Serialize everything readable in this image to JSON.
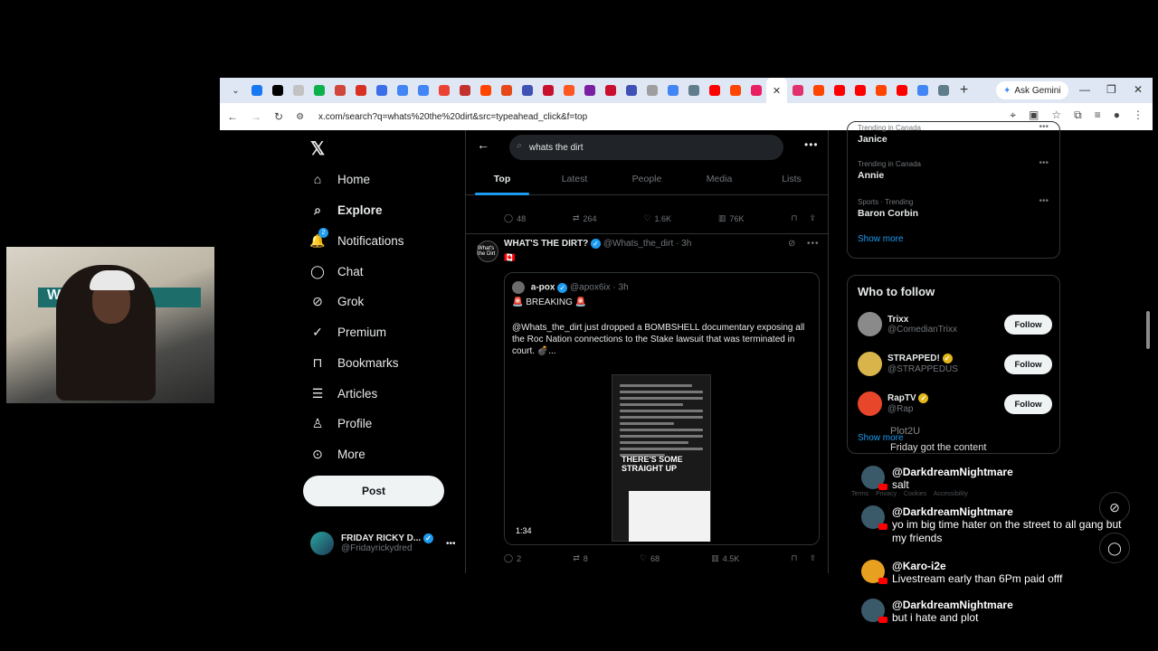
{
  "browser": {
    "url": "x.com/search?q=whats%20the%20dirt&src=typeahead_click&f=top",
    "gemini_label": "Ask Gemini",
    "tab_colors": [
      "#1877f2",
      "#000000",
      "#c2c2c2",
      "#0db14b",
      "#d1463a",
      "#d93025",
      "#3b6ee8",
      "#4285f4",
      "#4285f4",
      "#ea4335",
      "#c4302b",
      "#ff4500",
      "#e64a19",
      "#3f51b5",
      "#c8102e",
      "#ff5722",
      "#7b1fa2",
      "#c8102e",
      "#3f51b5",
      "#9e9e9e",
      "#4285f4",
      "#607d8b",
      "#ff0000",
      "#ff4500",
      "#e91e63"
    ],
    "tab_colors_after": [
      "#e1306c",
      "#ff4500",
      "#ff0000",
      "#ff0000",
      "#ff4500",
      "#ff0000",
      "#4285f4",
      "#607d8b"
    ]
  },
  "nav": {
    "logo": "𝕏",
    "items": [
      {
        "label": "Home",
        "icon": "home-icon",
        "glyph": "⌂"
      },
      {
        "label": "Explore",
        "icon": "search-icon",
        "glyph": "⌕"
      },
      {
        "label": "Notifications",
        "icon": "bell-icon",
        "glyph": "🔔"
      },
      {
        "label": "Chat",
        "icon": "chat-icon",
        "glyph": "◯"
      },
      {
        "label": "Grok",
        "icon": "grok-icon",
        "glyph": "⊘"
      },
      {
        "label": "Premium",
        "icon": "premium-icon",
        "glyph": "✓"
      },
      {
        "label": "Bookmarks",
        "icon": "bookmark-icon",
        "glyph": "⊓"
      },
      {
        "label": "Articles",
        "icon": "article-icon",
        "glyph": "☰"
      },
      {
        "label": "Profile",
        "icon": "profile-icon",
        "glyph": "♙"
      },
      {
        "label": "More",
        "icon": "more-icon",
        "glyph": "⊙"
      }
    ],
    "notif_count": "2",
    "post": "Post",
    "me": {
      "name": "FRIDAY RICKY D...",
      "handle": "@Fridayrickydred"
    }
  },
  "search": {
    "query": "whats the dirt",
    "tabs": [
      "Top",
      "Latest",
      "People",
      "Media",
      "Lists"
    ]
  },
  "prev_tweet_actions": {
    "replies": "48",
    "reposts": "264",
    "likes": "1.6K",
    "views": "76K"
  },
  "tweet": {
    "name": "WHAT'S THE DIRT?",
    "handle": "@Whats_the_dirt",
    "time": "· 3h",
    "flag": "🇨🇦",
    "avatar_text": "What's the Dirt",
    "quote": {
      "name": "a-pox",
      "handle": "@apox6ix",
      "time": "· 3h",
      "line1": "🚨 BREAKING 🚨",
      "line2": "@Whats_the_dirt just dropped a BOMBSHELL documentary exposing all the Roc Nation connections to the Stake lawsuit that was terminated in court. 💣...",
      "video_duration": "1:34",
      "overlay_line1": "THERE'S SOME",
      "overlay_line2": "STRAIGHT UP"
    },
    "actions": {
      "replies": "2",
      "reposts": "8",
      "likes": "68",
      "views": "4.5K"
    }
  },
  "trends": [
    {
      "context": "Trending in Canada",
      "title": "Janice"
    },
    {
      "context": "Trending in Canada",
      "title": "Annie"
    },
    {
      "context": "Sports · Trending",
      "title": "Baron Corbin"
    }
  ],
  "show_more": "Show more",
  "who_to_follow": {
    "title": "Who to follow",
    "follow_label": "Follow",
    "accounts": [
      {
        "name": "Trixx",
        "handle": "@ComedianTrixx",
        "color": "#8a8a8a"
      },
      {
        "name": "STRAPPED!",
        "handle": "@STRAPPEDUS",
        "color": "#d9b44a"
      },
      {
        "name": "RapTV",
        "handle": "@Rap",
        "color": "#e8462b"
      }
    ]
  },
  "footer": "Terms Privacy Cookies Accessibility",
  "chat": {
    "ghost_user": "Plot2U",
    "ghost_text": "Friday got the content",
    "messages": [
      {
        "user": "@DarkdreamNightmare",
        "text": "salt",
        "color": "#3a5a6a"
      },
      {
        "user": "@DarkdreamNightmare",
        "text": "yo im big time hater on the street to all gang but my friends",
        "color": "#3a5a6a"
      },
      {
        "user": "@Karo-i2e",
        "text": "Livestream early than 6Pm paid offf",
        "color": "#e8a020"
      },
      {
        "user": "@DarkdreamNightmare",
        "text": "but i hate and plot",
        "color": "#3a5a6a"
      }
    ]
  }
}
